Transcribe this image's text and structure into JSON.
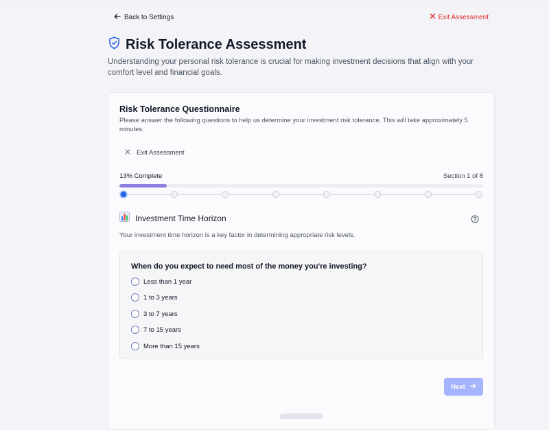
{
  "nav": {
    "back_label": "Back to Settings",
    "exit_label": "Exit Assessment"
  },
  "page": {
    "title": "Risk Tolerance Assessment",
    "intro": "Understanding your personal risk tolerance is crucial for making investment decisions that align with your comfort level and financial goals."
  },
  "questionnaire": {
    "title": "Risk Tolerance Questionnaire",
    "description": "Please answer the following questions to help us determine your investment risk tolerance. This will take approximately 5 minutes.",
    "exit_label": "Exit Assessment"
  },
  "progress": {
    "percent_label": "13% Complete",
    "percent": 13,
    "section_label": "Section 1 of 8",
    "total_steps": 8,
    "current_step": 1
  },
  "section": {
    "icon": "bar-chart-emoji-icon",
    "title": "Investment Time Horizon",
    "description": "Your investment time horizon is a key factor in determining appropriate risk levels."
  },
  "question": {
    "text": "When do you expect to need most of the money you're investing?",
    "options": [
      "Less than 1 year",
      "1 to 3 years",
      "3 to 7 years",
      "7 to 15 years",
      "More than 15 years"
    ]
  },
  "actions": {
    "next_label": "Next"
  },
  "colors": {
    "accent": "#2563eb",
    "danger": "#dc2626",
    "progress_fill": "#8b7fe0",
    "next_button_disabled": "#a5b4fc"
  }
}
